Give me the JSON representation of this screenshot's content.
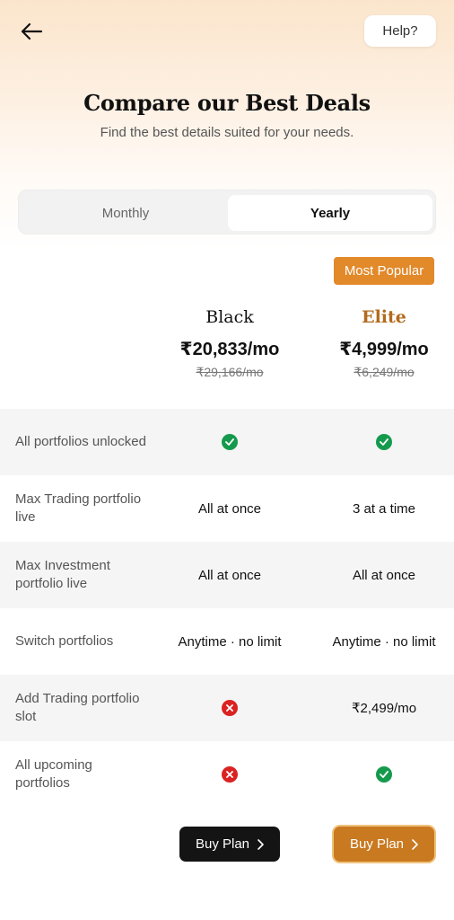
{
  "header": {
    "help_label": "Help?",
    "title": "Compare our Best Deals",
    "subtitle": "Find the best details suited for your needs."
  },
  "billing_toggle": {
    "options": [
      "Monthly",
      "Yearly"
    ],
    "selected": "Yearly"
  },
  "badge": "Most Popular",
  "plans": [
    {
      "name": "Black",
      "price": "₹20,833/mo",
      "old_price": "₹29,166/mo",
      "button": "Buy Plan"
    },
    {
      "name": "Elite",
      "price": "₹4,999/mo",
      "old_price": "₹6,249/mo",
      "button": "Buy Plan"
    }
  ],
  "features": [
    {
      "label": "All portfolios unlocked",
      "black": "check",
      "elite": "check"
    },
    {
      "label": "Max Trading portfolio live",
      "black": "All at once",
      "elite": "3 at a time"
    },
    {
      "label": "Max Investment portfolio live",
      "black": "All at once",
      "elite": "All at once"
    },
    {
      "label": "Switch portfolios",
      "black": "Anytime · no limit",
      "elite": "Anytime · no limit"
    },
    {
      "label": "Add Trading portfolio slot",
      "black": "cross",
      "elite": "₹2,499/mo"
    },
    {
      "label": "All upcoming portfolios",
      "black": "cross",
      "elite": "check"
    }
  ],
  "colors": {
    "accent": "#c9791f",
    "badge": "#e2892a",
    "check": "#159a4d",
    "cross": "#db2222"
  },
  "icons": {
    "back": "arrow-left-icon",
    "check": "check-circle-icon",
    "cross": "x-circle-icon",
    "chevron": "chevron-right-icon"
  }
}
